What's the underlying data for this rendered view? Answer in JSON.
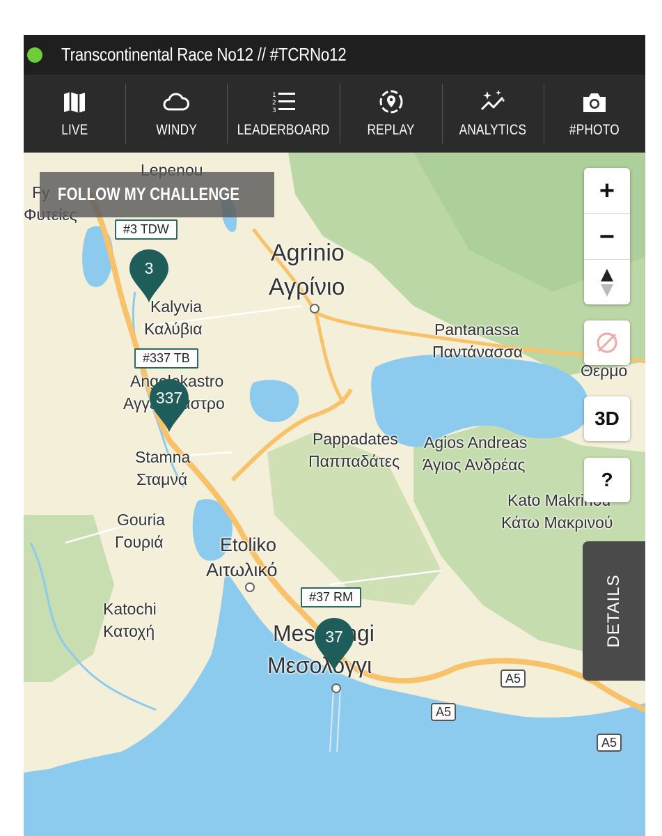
{
  "header": {
    "title": "Transcontinental Race No12 // #TCRNo12",
    "status_color": "#6fcd3a"
  },
  "nav": {
    "items": [
      {
        "label": "LIVE",
        "icon": "map-icon"
      },
      {
        "label": "WINDY",
        "icon": "cloud-icon"
      },
      {
        "label": "LEADERBOARD",
        "icon": "ranked-list-icon"
      },
      {
        "label": "REPLAY",
        "icon": "replay-pin-icon"
      },
      {
        "label": "ANALYTICS",
        "icon": "analytics-sparkle-icon"
      },
      {
        "label": "#PHOTO",
        "icon": "camera-icon"
      }
    ]
  },
  "map": {
    "follow_label": "FOLLOW MY CHALLENGE",
    "places": {
      "lepenou": "Lepenou",
      "fytieies_gr": "Φυτείες",
      "fy_partial": "Fy",
      "agrinio": "Agrinio",
      "agrinio_gr": "Αγρίνιο",
      "kalyvia": "Kalyvia",
      "kalyvia_gr": "Καλύβια",
      "pantanassa": "Pantanassa",
      "pantanassa_gr": "Παντάνασσα",
      "angelokastro": "Angelokastro",
      "angelokastro_gr": "Αγγελόκαστρο",
      "thermo_partial": "Θερμο",
      "pappadates": "Pappadates",
      "pappadates_gr": "Παππαδάτες",
      "agios_andreas": "Agios Andreas",
      "agios_andreas_gr": "Άγιος Ανδρέας",
      "stamna": "Stamna",
      "stamna_gr": "Σταμνά",
      "kato_makrinou": "Kato Makrinou",
      "kato_makrinou_gr": "Κάτω Μακρινού",
      "gouria": "Gouria",
      "gouria_gr": "Γουριά",
      "etoliko": "Etoliko",
      "etoliko_gr": "Αιτωλικό",
      "katochi": "Katochi",
      "katochi_gr": "Κατοχή",
      "mesolongi": "Mesolongi",
      "mesolongi_gr": "Μεσολόγγι"
    },
    "road_shields": [
      "A5",
      "A5",
      "A5"
    ],
    "riders": [
      {
        "tag": "#3 TDW",
        "number": "3"
      },
      {
        "tag": "#337 TB",
        "number": "337"
      },
      {
        "tag": "#37 RM",
        "number": "37"
      }
    ],
    "controls": {
      "zoom_in": "+",
      "zoom_out": "−",
      "three_d": "3D",
      "help": "?",
      "details": "DETAILS"
    },
    "colors": {
      "water": "#8ccbed",
      "land": "#f3efd9",
      "forest": "#b9d6a4",
      "highway": "#f7c26a",
      "pin": "#1f5d5b"
    }
  }
}
